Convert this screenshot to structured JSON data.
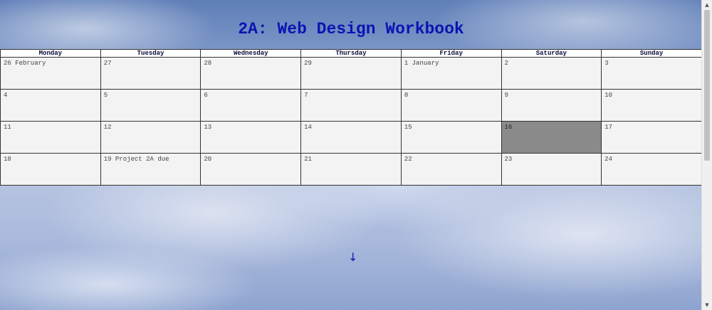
{
  "page": {
    "title": "2A: Web Design Workbook"
  },
  "calendar": {
    "weekdays": [
      "Monday",
      "Tuesday",
      "Wednesday",
      "Thursday",
      "Friday",
      "Saturday",
      "Sunday"
    ],
    "weeks": [
      [
        "26 February",
        "27",
        "28",
        "29",
        "1 January",
        "2",
        "3"
      ],
      [
        "4",
        "5",
        "6",
        "7",
        "8",
        "9",
        "10"
      ],
      [
        "11",
        "12",
        "13",
        "14",
        "15",
        "16",
        "17"
      ],
      [
        "18",
        "19 Project 2A due",
        "20",
        "21",
        "22",
        "23",
        "24"
      ]
    ],
    "highlighted_day": "16"
  },
  "nav": {
    "down_arrow": "↓"
  },
  "scrollbar": {
    "up_glyph": "▲",
    "down_glyph": "▼"
  },
  "colors": {
    "title": "#0a14b4",
    "highlight_cell": "#8a8a8a",
    "cell": "#f3f3f3"
  }
}
